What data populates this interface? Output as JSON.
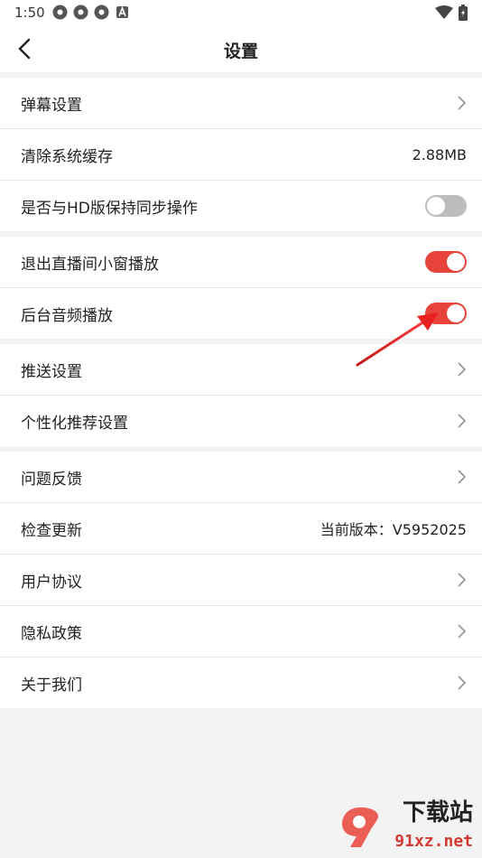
{
  "status_bar": {
    "time": "1:50",
    "notification_icons": [
      "app-icon",
      "app-icon",
      "app-icon",
      "a-badge-icon"
    ],
    "right_icons": [
      "wifi-icon",
      "battery-icon"
    ]
  },
  "header": {
    "title": "设置"
  },
  "groups": [
    {
      "rows": [
        {
          "label": "弹幕设置",
          "type": "chevron"
        },
        {
          "label": "清除系统缓存",
          "type": "value",
          "value": "2.88MB"
        },
        {
          "label": "是否与HD版保持同步操作",
          "type": "toggle",
          "on": false
        }
      ]
    },
    {
      "rows": [
        {
          "label": "退出直播间小窗播放",
          "type": "toggle",
          "on": true
        },
        {
          "label": "后台音频播放",
          "type": "toggle",
          "on": true
        }
      ]
    },
    {
      "rows": [
        {
          "label": "推送设置",
          "type": "chevron"
        },
        {
          "label": "个性化推荐设置",
          "type": "chevron"
        }
      ]
    },
    {
      "rows": [
        {
          "label": "问题反馈",
          "type": "chevron"
        },
        {
          "label": "检查更新",
          "type": "value",
          "value": "当前版本：V5952025"
        },
        {
          "label": "用户协议",
          "type": "chevron"
        },
        {
          "label": "隐私政策",
          "type": "chevron"
        },
        {
          "label": "关于我们",
          "type": "chevron"
        }
      ]
    }
  ],
  "watermark": {
    "brand": "下载站",
    "url": "91xz.net"
  },
  "colors": {
    "accent": "#e8433a",
    "toggle_off": "#bdbdbd",
    "background": "#f3f3f3"
  }
}
